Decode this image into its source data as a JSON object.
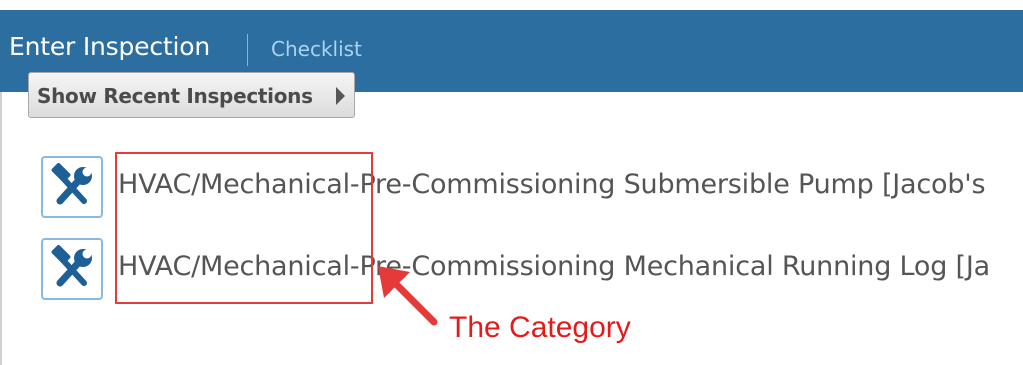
{
  "header": {
    "title": "Enter Inspection",
    "tabs": [
      {
        "label": "Checklist"
      }
    ]
  },
  "recent_button": {
    "label": "Show Recent Inspections"
  },
  "items": [
    {
      "text": "HVAC/Mechanical-Pre-Commissioning Submersible Pump [Jacob's",
      "icon": "hammer-wrench-icon"
    },
    {
      "text": "HVAC/Mechanical-Pre-Commissioning Mechanical Running Log [Ja",
      "icon": "hammer-wrench-icon"
    }
  ],
  "annotation": {
    "label": "The Category",
    "color": "#e31b1b"
  },
  "colors": {
    "header_bg": "#2c6e9f",
    "tab_link": "#a9d3f2",
    "icon_blue": "#86b9e4"
  }
}
